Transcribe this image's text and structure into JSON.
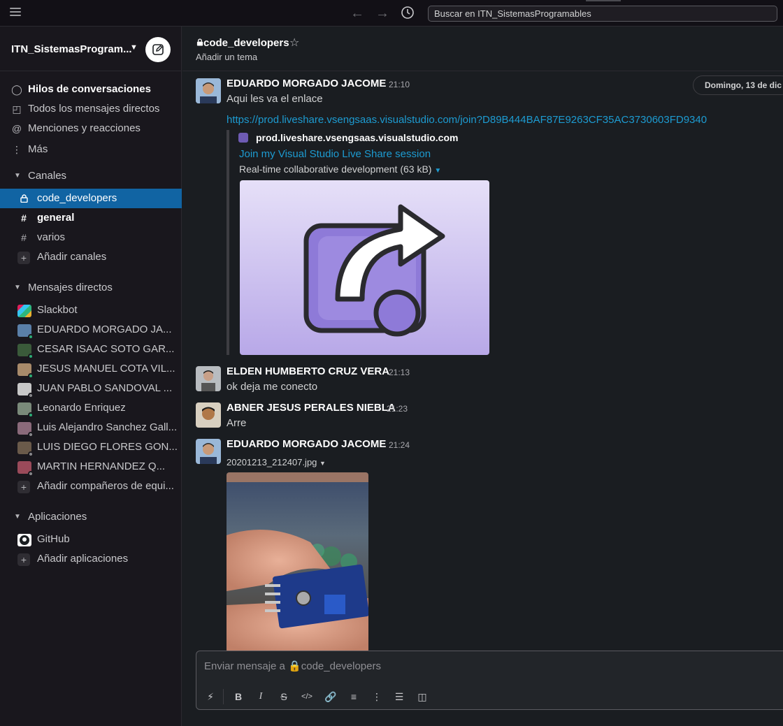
{
  "topbar": {
    "search_placeholder": "Buscar en ITN_SistemasProgramables",
    "icons": [
      "menu-icon",
      "back-arrow-icon",
      "forward-arrow-icon",
      "history-icon"
    ]
  },
  "workspace": {
    "name": "ITN_SistemasProgram..."
  },
  "sidebar": {
    "nav": [
      {
        "label": "Hilos de conversaciones",
        "icon": "threads-icon",
        "bold": true
      },
      {
        "label": "Todos los mensajes directos",
        "icon": "dms-icon"
      },
      {
        "label": "Menciones y reacciones",
        "icon": "at-icon"
      },
      {
        "label": "Más",
        "icon": "more-icon"
      }
    ],
    "channels_header": "Canales",
    "channels": [
      {
        "label": "code_developers",
        "prefix": "🔒",
        "active": true
      },
      {
        "label": "general",
        "prefix": "#",
        "bold": true
      },
      {
        "label": "varios",
        "prefix": "#"
      }
    ],
    "add_channels": "Añadir canales",
    "dms_header": "Mensajes directos",
    "dms": [
      {
        "label": "Slackbot",
        "status": "none"
      },
      {
        "label": "EDUARDO MORGADO JA...",
        "status": "on"
      },
      {
        "label": "CESAR ISAAC SOTO GAR...",
        "status": "on"
      },
      {
        "label": "JESUS MANUEL COTA VIL...",
        "status": "on"
      },
      {
        "label": "JUAN PABLO SANDOVAL ...",
        "status": "off"
      },
      {
        "label": "Leonardo Enriquez",
        "status": "on"
      },
      {
        "label": "Luis Alejandro Sanchez Gall...",
        "status": "off"
      },
      {
        "label": "LUIS DIEGO FLORES GON...",
        "status": "off"
      },
      {
        "label": "MARTIN HERNANDEZ Q...",
        "status": "off"
      }
    ],
    "add_teammates": "Añadir compañeros de equi...",
    "apps_header": "Aplicaciones",
    "apps": [
      {
        "label": "GitHub"
      }
    ],
    "add_apps": "Añadir aplicaciones"
  },
  "channel": {
    "name": "code_developers",
    "topic": "Añadir un tema",
    "date_divider": "Domingo, 13 de dic"
  },
  "messages": [
    {
      "author": "EDUARDO MORGADO JACOME",
      "time": "21:10",
      "text": "Aqui les va el enlace",
      "link": "https://prod.liveshare.vsengsaas.visualstudio.com/join?D89B444BAF87E9263CF35AC3730603FD9340",
      "unfurl": {
        "site": "prod.liveshare.vsengsaas.visualstudio.com",
        "title": "Join my Visual Studio Live Share session",
        "description": "Real-time collaborative development (63 kB)"
      }
    },
    {
      "author": "ELDEN HUMBERTO CRUZ VERA",
      "time": "21:13",
      "text": "ok deja me conecto"
    },
    {
      "author": "ABNER JESUS PERALES NIEBLA",
      "time": "21:23",
      "text": "Arre"
    },
    {
      "author": "EDUARDO MORGADO JACOME",
      "time": "21:24",
      "file": "20201213_212407.jpg"
    }
  ],
  "composer": {
    "placeholder": "Enviar mensaje a 🔒code_developers",
    "tools": [
      "shortcuts-icon",
      "bold-icon",
      "italic-icon",
      "strikethrough-icon",
      "code-icon",
      "link-icon",
      "ordered-list-icon",
      "bulleted-list-icon",
      "blockquote-icon",
      "code-block-icon"
    ]
  }
}
